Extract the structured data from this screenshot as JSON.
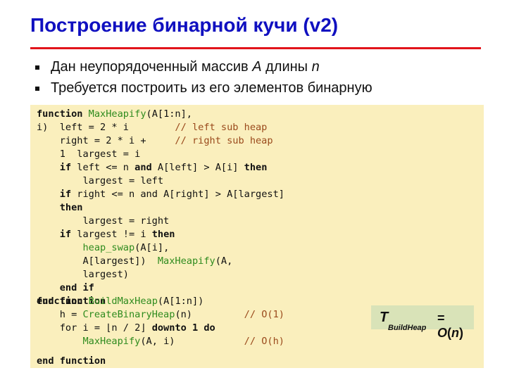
{
  "slide": {
    "title": "Построение бинарной кучи (v2)",
    "bullets": [
      {
        "before": "Дан неупорядоченный массив ",
        "var1": "A",
        "middle": " длины ",
        "var2": "n"
      },
      {
        "before": "Требуется построить из его элементов бинарную",
        "var1": "",
        "middle": "",
        "var2": ""
      }
    ],
    "colors": {
      "title": "#1010c0",
      "rule": "#e2141b",
      "code_background": "#faefbd",
      "function_name": "#2e8b1e",
      "comment": "#9a4a1c",
      "formula_background": "#d9e3b8"
    }
  },
  "code": {
    "lines": [
      [
        {
          "t": "function",
          "c": "kw"
        },
        {
          "t": " "
        },
        {
          "t": "MaxHeapify",
          "c": "fn"
        },
        {
          "t": "(A[1:n],"
        }
      ],
      [
        {
          "t": "i)  left = 2 * i        "
        },
        {
          "t": "// left sub heap",
          "c": "cm"
        }
      ],
      [
        {
          "t": "    right = 2 * i +     "
        },
        {
          "t": "// right sub heap",
          "c": "cm"
        }
      ],
      [
        {
          "t": "    1  largest = i"
        }
      ],
      [
        {
          "t": "    "
        },
        {
          "t": "if",
          "c": "kw"
        },
        {
          "t": " left <= n "
        },
        {
          "t": "and",
          "c": "kw"
        },
        {
          "t": " A[left] > A[i] "
        },
        {
          "t": "then",
          "c": "kw"
        }
      ],
      [
        {
          "t": "        largest = left"
        }
      ],
      [
        {
          "t": "    "
        },
        {
          "t": "if",
          "c": "kw"
        },
        {
          "t": " right <= n and A[right] > A[largest]"
        }
      ],
      [
        {
          "t": "    "
        },
        {
          "t": "then",
          "c": "kw"
        }
      ],
      [
        {
          "t": "        largest = right"
        }
      ],
      [
        {
          "t": "    "
        },
        {
          "t": "if",
          "c": "kw"
        },
        {
          "t": " largest != i "
        },
        {
          "t": "then",
          "c": "kw"
        }
      ],
      [
        {
          "t": "        "
        },
        {
          "t": "heap_swap",
          "c": "fn"
        },
        {
          "t": "(A[i],"
        }
      ],
      [
        {
          "t": "        A[largest])  "
        },
        {
          "t": "MaxHeapify",
          "c": "fn"
        },
        {
          "t": "(A,"
        }
      ],
      [
        {
          "t": "        largest)"
        }
      ],
      [
        {
          "t": "    "
        },
        {
          "t": "end if",
          "c": "kw"
        }
      ],
      [
        {
          "t": "end function",
          "c": "kw"
        }
      ],
      [
        {
          "t": "function",
          "c": "kw"
        },
        {
          "t": " "
        },
        {
          "t": "BuildMaxHeap",
          "c": "fn"
        },
        {
          "t": "(A[1:n])"
        }
      ],
      [
        {
          "t": "    h = "
        },
        {
          "t": "CreateBinaryHeap",
          "c": "fn"
        },
        {
          "t": "(n)         "
        },
        {
          "t": "// O(1)",
          "c": "cm"
        }
      ],
      [
        {
          "t": "    for i = ⌊n / 2⌋ "
        },
        {
          "t": "downto 1 do",
          "c": "kw"
        }
      ],
      [
        {
          "t": "        "
        },
        {
          "t": "MaxHeapify",
          "c": "fn"
        },
        {
          "t": "(A, i)            "
        },
        {
          "t": "// O(h)",
          "c": "cm"
        }
      ],
      [
        {
          "t": "end function",
          "c": "kw"
        }
      ]
    ]
  },
  "formula": {
    "symbol": "T",
    "subscript": "BuildHeap",
    "equals": "= ",
    "rhs_func": "O",
    "rhs_open": "(",
    "rhs_var": "n",
    "rhs_close": ")"
  }
}
